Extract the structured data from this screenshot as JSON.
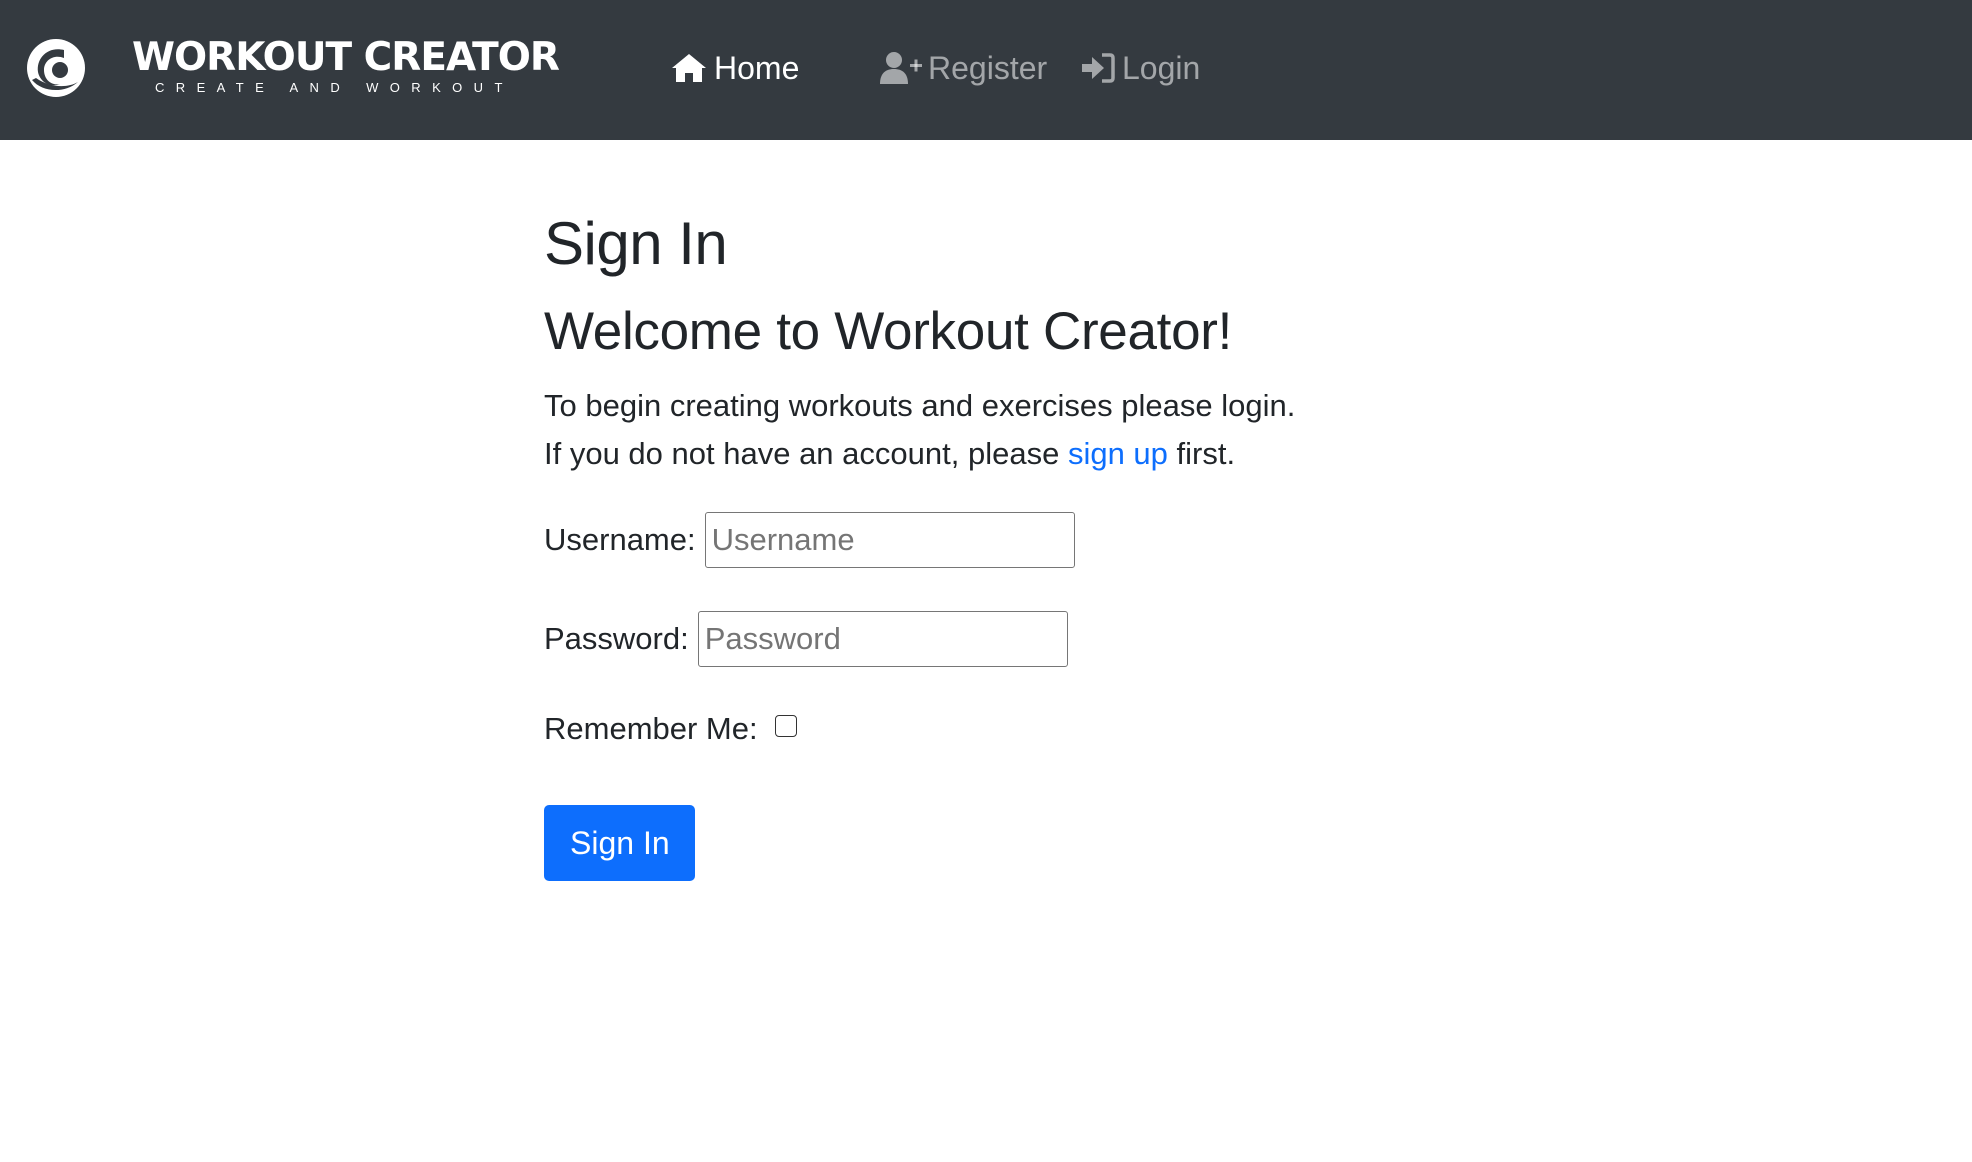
{
  "nav": {
    "brand_title": "WORKOUT CREATOR",
    "brand_tagline": "CREATE AND WORKOUT",
    "home_label": "Home",
    "register_label": "Register",
    "login_label": "Login"
  },
  "page": {
    "title": "Sign In",
    "welcome": "Welcome to Workout Creator!",
    "intro_line1": "To begin creating workouts and exercises please login.",
    "intro_line2_pre": "If you do not have an account, please ",
    "intro_link": "sign up",
    "intro_line2_post": " first."
  },
  "form": {
    "username_label": "Username:",
    "username_placeholder": "Username",
    "username_value": "",
    "password_label": "Password:",
    "password_placeholder": "Password",
    "password_value": "",
    "remember_label": "Remember Me:",
    "remember_checked": false,
    "submit_label": "Sign In"
  },
  "colors": {
    "navbar_bg": "#343a40",
    "primary": "#0d6efd",
    "text": "#212529"
  },
  "icons": {
    "brand": "swirl-logo-icon",
    "home": "house-icon",
    "register": "user-plus-icon",
    "login": "sign-in-icon"
  }
}
